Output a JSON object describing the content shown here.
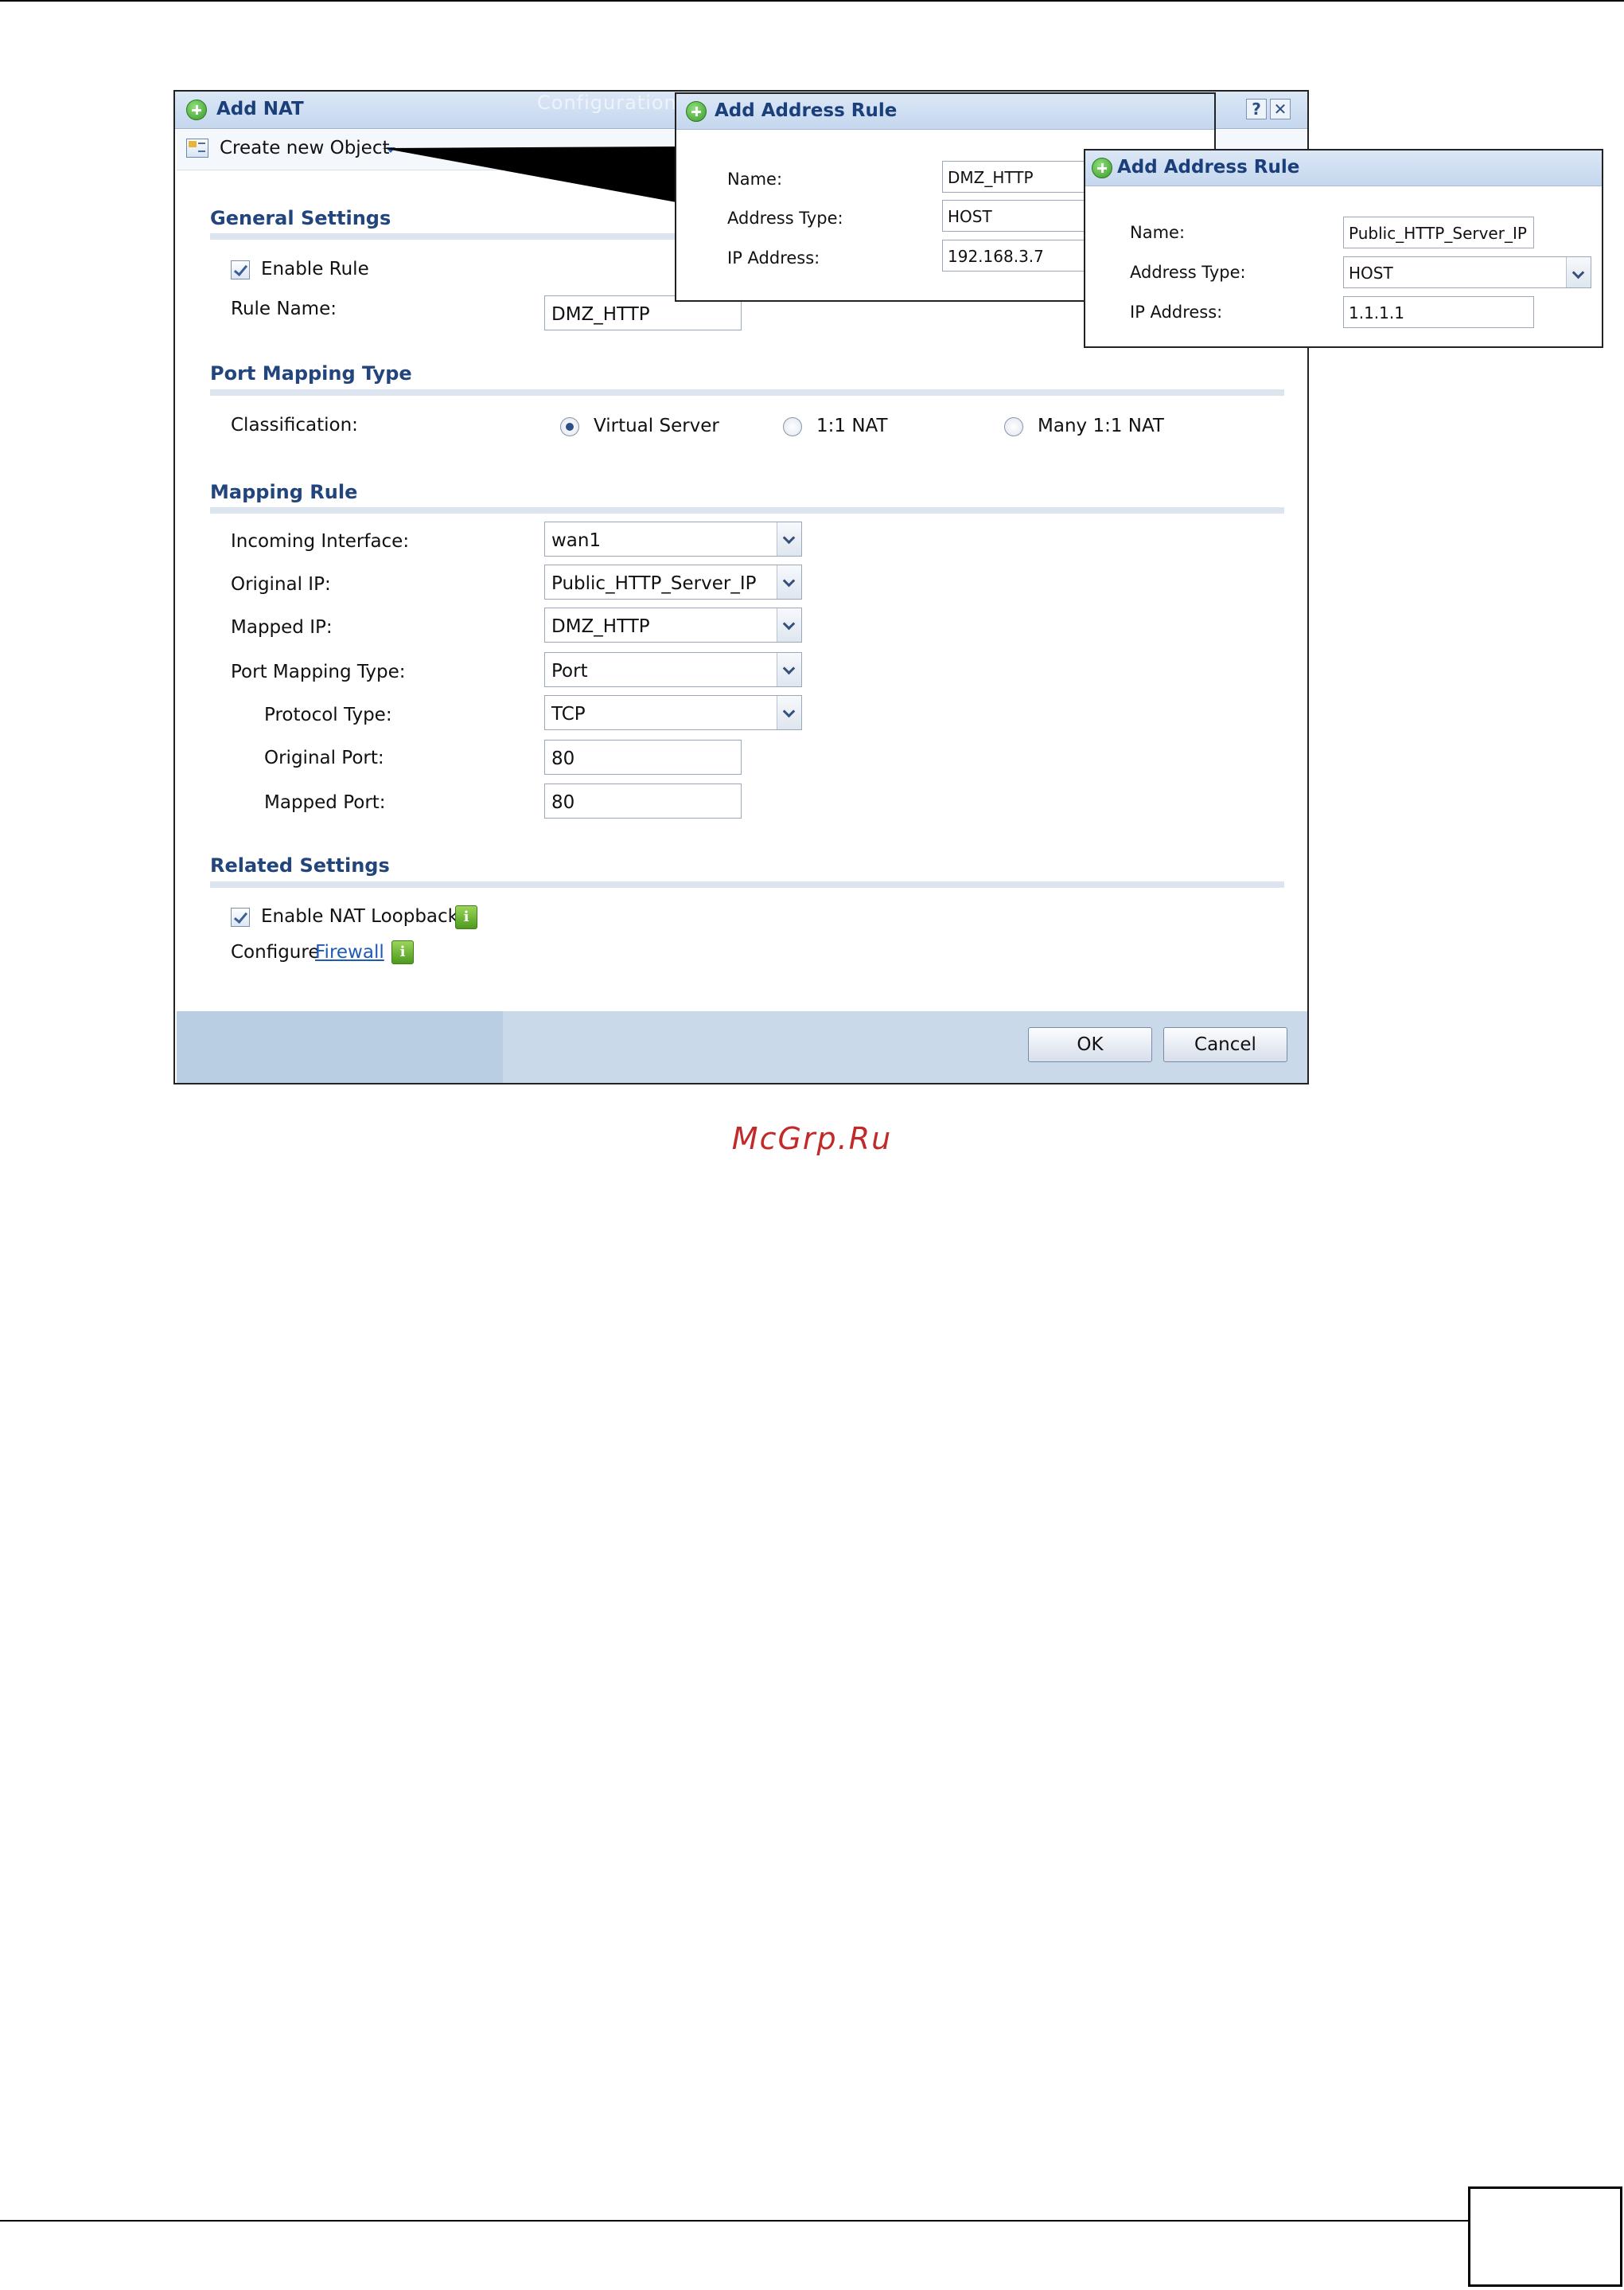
{
  "main_dialog": {
    "title": "Add NAT",
    "bg_tab_text": "Configuration",
    "help_label": "?",
    "close_label": "✕",
    "toolbar": {
      "create_object_label": "Create new Object",
      "create_object_icon": "object-icon"
    },
    "general_settings": {
      "title": "General Settings",
      "enable_rule_label": "Enable Rule",
      "enable_rule_checked": true,
      "rule_name_label": "Rule Name:",
      "rule_name_value": "DMZ_HTTP"
    },
    "port_mapping_type": {
      "title": "Port Mapping Type",
      "classification_label": "Classification:",
      "options": [
        "Virtual Server",
        "1:1 NAT",
        "Many 1:1 NAT"
      ],
      "selected": "Virtual Server"
    },
    "mapping_rule": {
      "title": "Mapping Rule",
      "incoming_interface_label": "Incoming Interface:",
      "incoming_interface_value": "wan1",
      "original_ip_label": "Original IP:",
      "original_ip_value": "Public_HTTP_Server_IP",
      "mapped_ip_label": "Mapped IP:",
      "mapped_ip_value": "DMZ_HTTP",
      "port_mapping_type_label": "Port Mapping Type:",
      "port_mapping_type_value": "Port",
      "protocol_type_label": "Protocol Type:",
      "protocol_type_value": "TCP",
      "original_port_label": "Original Port:",
      "original_port_value": "80",
      "mapped_port_label": "Mapped Port:",
      "mapped_port_value": "80"
    },
    "related_settings": {
      "title": "Related Settings",
      "nat_loopback_label": "Enable NAT Loopback",
      "nat_loopback_checked": true,
      "configure_label": "Configure",
      "firewall_link": "Firewall",
      "info_glyph": "i"
    },
    "buttons": {
      "ok": "OK",
      "cancel": "Cancel"
    }
  },
  "address_rule_popup_1": {
    "title": "Add Address Rule",
    "name_label": "Name:",
    "name_value": "DMZ_HTTP",
    "type_label": "Address Type:",
    "type_value": "HOST",
    "ip_label": "IP Address:",
    "ip_value": "192.168.3.7"
  },
  "address_rule_popup_2": {
    "title": "Add Address Rule",
    "name_label": "Name:",
    "name_value": "Public_HTTP_Server_IP",
    "type_label": "Address Type:",
    "type_value": "HOST",
    "ip_label": "IP Address:",
    "ip_value": "1.1.1.1"
  },
  "watermark": "McGrp.Ru",
  "colors": {
    "accent": "#22457d",
    "header_bg": "#c5d7ee",
    "footer_bg": "#c9d9ea",
    "watermark": "#c22a2a"
  }
}
